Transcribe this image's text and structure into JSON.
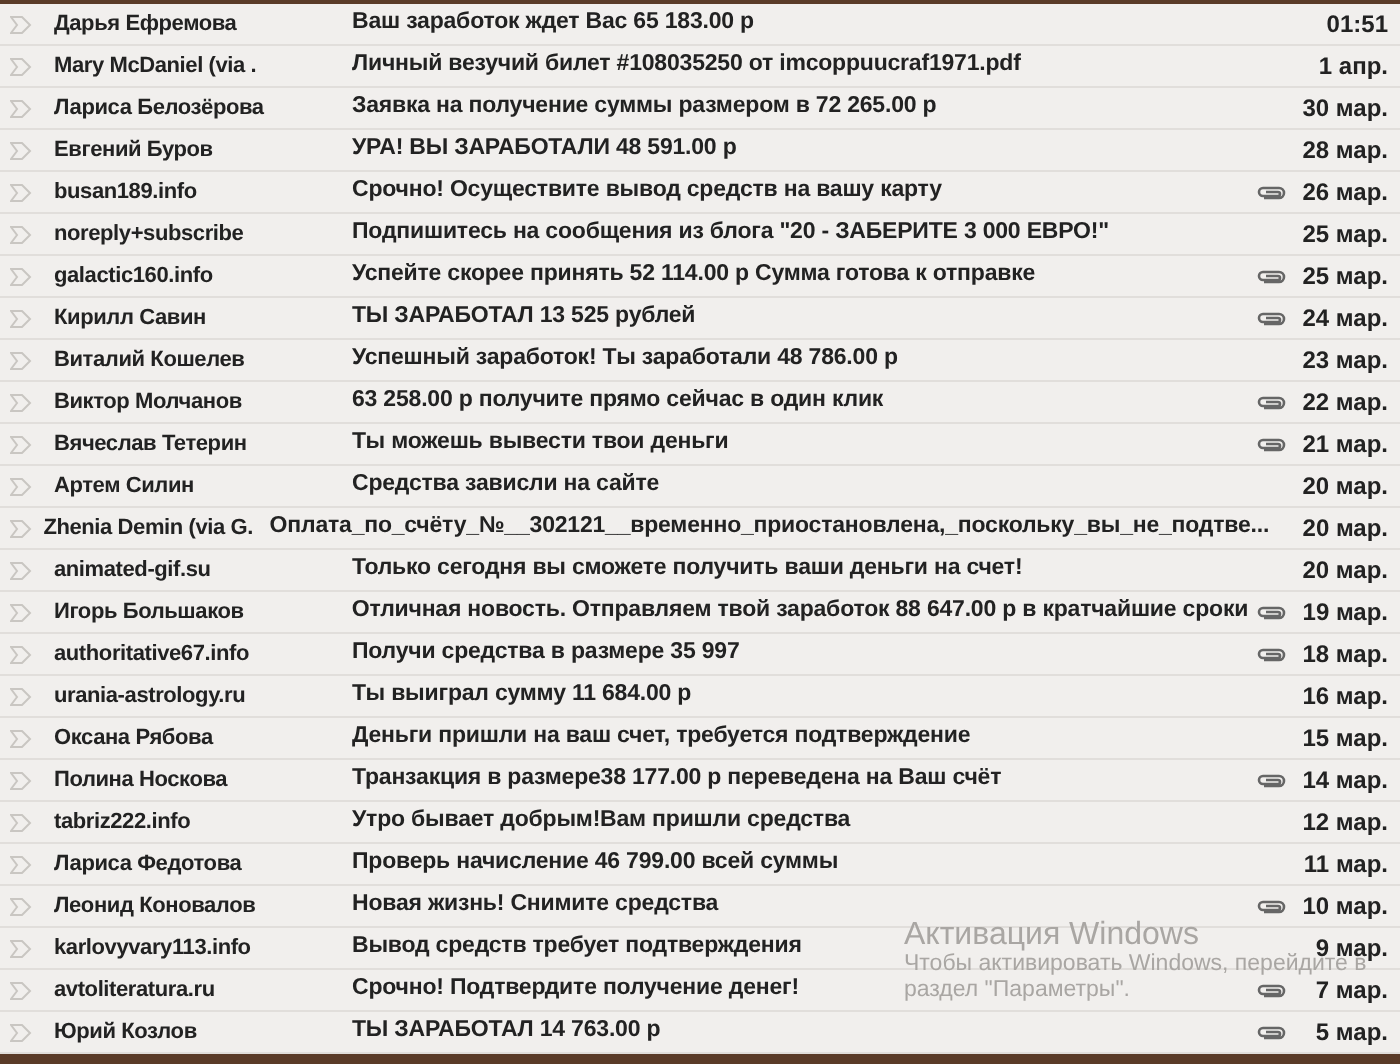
{
  "messages": [
    {
      "sender": "Дарья Ефремова",
      "subject": "Ваш заработок ждет Вас 65 183.00 р",
      "attachment": false,
      "date": "01:51"
    },
    {
      "sender": "Mary McDaniel (via .",
      "subject": "Личный везучий билет #108035250 от imcoppuucraf1971.pdf",
      "attachment": false,
      "date": "1 апр."
    },
    {
      "sender": "Лариса Белозёрова",
      "subject": "Заявка на получение суммы размером в 72 265.00 р",
      "attachment": false,
      "date": "30 мар."
    },
    {
      "sender": "Евгений Буров",
      "subject": "УРА! ВЫ ЗАРАБОТАЛИ 48 591.00 р",
      "attachment": false,
      "date": "28 мар."
    },
    {
      "sender": "busan189.info",
      "subject": "Срочно! Осуществите вывод средств на вашу карту",
      "attachment": true,
      "date": "26 мар."
    },
    {
      "sender": "noreply+subscribe",
      "subject": "Подпишитесь на сообщения из блога \"20 - ЗАБЕРИТЕ 3 000 ЕВРО!\"",
      "attachment": false,
      "date": "25 мар."
    },
    {
      "sender": "galactic160.info",
      "subject": "Успейте скорее принять 52 114.00 р Сумма готова к отправке",
      "attachment": true,
      "date": "25 мар."
    },
    {
      "sender": "Кирилл Савин",
      "subject": "ТЫ ЗАРАБОТАЛ 13 525 рублей",
      "attachment": true,
      "date": "24 мар."
    },
    {
      "sender": "Виталий Кошелев",
      "subject": "Успешный заработок! Ты заработали 48 786.00 р",
      "attachment": false,
      "date": "23 мар."
    },
    {
      "sender": "Виктор Молчанов",
      "subject": "63 258.00 р получите прямо сейчас в один клик",
      "attachment": true,
      "date": "22 мар."
    },
    {
      "sender": "Вячеслав Тетерин",
      "subject": "Ты можешь вывести твои деньги",
      "attachment": true,
      "date": "21 мар."
    },
    {
      "sender": "Артем Силин",
      "subject": "Средства зависли на сайте",
      "attachment": false,
      "date": "20 мар."
    },
    {
      "sender": "Zhenia Demin (via G.",
      "subject": "Оплата_по_счёту_№__302121__временно_приостановлена,_поскольку_вы_не_подтве...",
      "attachment": false,
      "date": "20 мар."
    },
    {
      "sender": "animated-gif.su",
      "subject": "Только сегодня вы сможете получить ваши деньги на счет!",
      "attachment": false,
      "date": "20 мар."
    },
    {
      "sender": "Игорь Большаков",
      "subject": "Отличная новость. Отправляем твой заработок 88 647.00 р в кратчайшие сроки",
      "attachment": true,
      "date": "19 мар."
    },
    {
      "sender": "authoritative67.info",
      "subject": "Получи средства в размере 35 997",
      "attachment": true,
      "date": "18 мар."
    },
    {
      "sender": "urania-astrology.ru",
      "subject": "Ты выиграл сумму 11 684.00 р",
      "attachment": false,
      "date": "16 мар."
    },
    {
      "sender": "Оксана Рябова",
      "subject": "Деньги пришли на ваш счет, требуется подтверждение",
      "attachment": false,
      "date": "15 мар."
    },
    {
      "sender": "Полина Носкова",
      "subject": "Транзакция в размере38 177.00 р переведена на Ваш счёт",
      "attachment": true,
      "date": "14 мар."
    },
    {
      "sender": "tabriz222.info",
      "subject": "Утро бывает добрым!Вам пришли средства",
      "attachment": false,
      "date": "12 мар."
    },
    {
      "sender": "Лариса Федотова",
      "subject": "Проверь начисление 46 799.00 всей суммы",
      "attachment": false,
      "date": "11 мар."
    },
    {
      "sender": "Леонид Коновалов",
      "subject": "Новая жизнь! Снимите средства",
      "attachment": true,
      "date": "10 мар."
    },
    {
      "sender": "karlovyvary113.info",
      "subject": "Вывод средств требует подтверждения",
      "attachment": false,
      "date": "9 мар."
    },
    {
      "sender": "avtoliteratura.ru",
      "subject": "Срочно! Подтвердите получение денег!",
      "attachment": true,
      "date": "7 мар."
    },
    {
      "sender": "Юрий Козлов",
      "subject": "ТЫ ЗАРАБОТАЛ 14 763.00 р",
      "attachment": true,
      "date": "5 мар."
    }
  ],
  "activation_notice": {
    "title": "Активация Windows",
    "line_1": "Чтобы активировать Windows, перейдите в",
    "line_2": "раздел \"Параметры\"."
  }
}
